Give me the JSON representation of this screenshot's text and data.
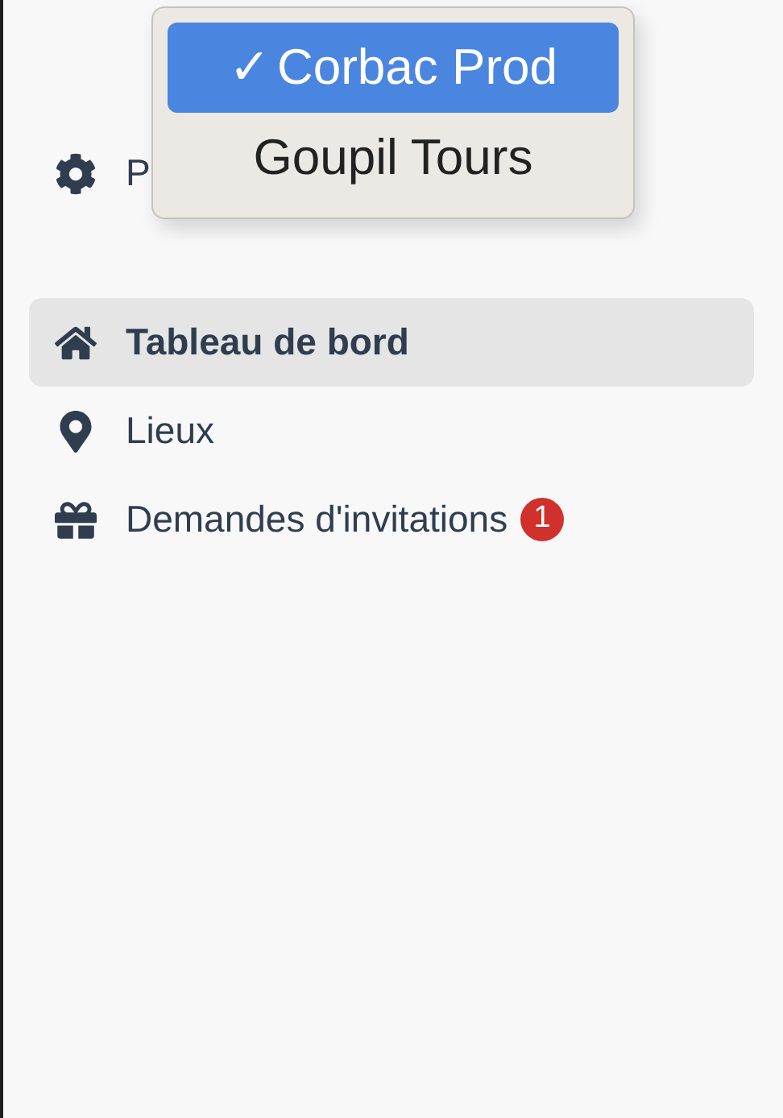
{
  "sidebar": {
    "items": [
      {
        "kind": "settings",
        "label": "P",
        "selected": false
      },
      {
        "kind": "home",
        "label": "Tableau de bord",
        "selected": true
      },
      {
        "kind": "pin",
        "label": "Lieux",
        "selected": false
      },
      {
        "kind": "gift",
        "label": "Demandes d'invitations",
        "selected": false,
        "badge": "1"
      }
    ]
  },
  "dropdown": {
    "options": [
      {
        "mark": "✓",
        "label": "Corbac Prod",
        "selected": true
      },
      {
        "label": "Goupil Tours",
        "selected": false
      }
    ]
  }
}
